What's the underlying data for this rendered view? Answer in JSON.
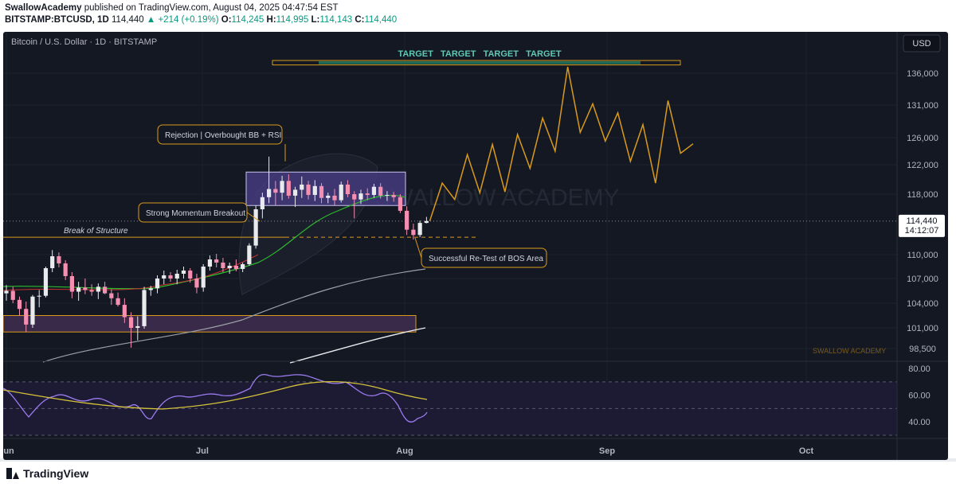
{
  "header": {
    "author": "SwallowAcademy",
    "published_text": " published on TradingView.com, August 04, 2025 04:47:54 EST",
    "symbol": "BITSTAMP:BTCUSD, 1D",
    "last": "114,440",
    "change": "▲ +214 (+0.19%)",
    "o_label": "O:",
    "o_value": "114,245",
    "h_label": "H:",
    "h_value": "114,995",
    "l_label": "L:",
    "l_value": "114,143",
    "c_label": "C:",
    "c_value": "114,440"
  },
  "chart_title": "Bitcoin / U.S. Dollar · 1D · BITSTAMP",
  "currency_button": "USD",
  "price_tag": {
    "price": "114,440",
    "countdown": "14:12:07"
  },
  "watermark": "SWALLOW ACADEMY",
  "corner_label": "SWALLOW ACADEMY",
  "target_label": "TARGET   TARGET   TARGET   TARGET",
  "annotations": {
    "rejection": "Rejection | Overbought BB + RSI",
    "momentum": "Strong Momentum Breakout",
    "bos": "Break of Structure",
    "retest": "Successful Re-Test of BOS Area"
  },
  "colors": {
    "background": "#141823",
    "up": "#e8eaed",
    "down": "#f48fb1",
    "accent": "#d99a1c",
    "target_fill": "#1f6b56",
    "sma_fast": "#2db92d",
    "rsi": "#9b7bf0",
    "rsi_ma": "#d4c33a"
  },
  "footer": {
    "brand": "TradingView"
  },
  "chart_data": {
    "type": "candlestick",
    "title": "Bitcoin / U.S. Dollar · 1D · BITSTAMP",
    "y_ticks": [
      136000,
      131000,
      126000,
      122000,
      118000,
      110000,
      107000,
      104000,
      101000,
      98500
    ],
    "y_tick_labels": [
      "136,000",
      "131,000",
      "126,000",
      "122,000",
      "118,000",
      "110,000",
      "107,000",
      "104,000",
      "101,000",
      "98,500"
    ],
    "x_labels": [
      "Jun",
      "Jul",
      "Aug",
      "Sep",
      "Oct"
    ],
    "last_price": 114440,
    "candles": [
      {
        "o": 105200,
        "h": 106200,
        "l": 104300,
        "c": 105500
      },
      {
        "o": 105500,
        "h": 106000,
        "l": 104000,
        "c": 104400
      },
      {
        "o": 104400,
        "h": 104800,
        "l": 102500,
        "c": 103300
      },
      {
        "o": 103300,
        "h": 104200,
        "l": 100500,
        "c": 101400
      },
      {
        "o": 101400,
        "h": 105000,
        "l": 101000,
        "c": 104800
      },
      {
        "o": 104800,
        "h": 105600,
        "l": 103500,
        "c": 104900
      },
      {
        "o": 104900,
        "h": 108500,
        "l": 104700,
        "c": 108300
      },
      {
        "o": 108300,
        "h": 110600,
        "l": 107800,
        "c": 109800
      },
      {
        "o": 109800,
        "h": 110300,
        "l": 108400,
        "c": 108900
      },
      {
        "o": 108900,
        "h": 109300,
        "l": 106800,
        "c": 107300
      },
      {
        "o": 107300,
        "h": 107800,
        "l": 104600,
        "c": 105400
      },
      {
        "o": 105400,
        "h": 106600,
        "l": 104300,
        "c": 105900
      },
      {
        "o": 105900,
        "h": 107000,
        "l": 105100,
        "c": 105600
      },
      {
        "o": 105600,
        "h": 106300,
        "l": 104900,
        "c": 105400
      },
      {
        "o": 105400,
        "h": 106400,
        "l": 104500,
        "c": 106000
      },
      {
        "o": 106000,
        "h": 106600,
        "l": 105100,
        "c": 105200
      },
      {
        "o": 105200,
        "h": 105700,
        "l": 103800,
        "c": 104600
      },
      {
        "o": 104600,
        "h": 105300,
        "l": 103600,
        "c": 103800
      },
      {
        "o": 103800,
        "h": 104600,
        "l": 101600,
        "c": 102300
      },
      {
        "o": 102300,
        "h": 102900,
        "l": 98600,
        "c": 101000
      },
      {
        "o": 101000,
        "h": 102400,
        "l": 99500,
        "c": 101200
      },
      {
        "o": 101200,
        "h": 106000,
        "l": 100900,
        "c": 105600
      },
      {
        "o": 105600,
        "h": 106100,
        "l": 104900,
        "c": 105800
      },
      {
        "o": 105800,
        "h": 107400,
        "l": 105200,
        "c": 107000
      },
      {
        "o": 107000,
        "h": 108000,
        "l": 106300,
        "c": 107400
      },
      {
        "o": 107400,
        "h": 107800,
        "l": 106600,
        "c": 107000
      },
      {
        "o": 107000,
        "h": 108100,
        "l": 106300,
        "c": 107600
      },
      {
        "o": 107600,
        "h": 108500,
        "l": 107000,
        "c": 108000
      },
      {
        "o": 108000,
        "h": 108300,
        "l": 106500,
        "c": 107000
      },
      {
        "o": 107000,
        "h": 107600,
        "l": 105200,
        "c": 105900
      },
      {
        "o": 105900,
        "h": 108800,
        "l": 105400,
        "c": 108500
      },
      {
        "o": 108500,
        "h": 109900,
        "l": 108000,
        "c": 109400
      },
      {
        "o": 109400,
        "h": 110100,
        "l": 108400,
        "c": 109000
      },
      {
        "o": 109000,
        "h": 109600,
        "l": 107800,
        "c": 108300
      },
      {
        "o": 108300,
        "h": 109000,
        "l": 107600,
        "c": 108600
      },
      {
        "o": 108600,
        "h": 109400,
        "l": 107900,
        "c": 108200
      },
      {
        "o": 108200,
        "h": 109000,
        "l": 107800,
        "c": 108800
      },
      {
        "o": 108800,
        "h": 111500,
        "l": 108600,
        "c": 111200
      },
      {
        "o": 111200,
        "h": 116500,
        "l": 110800,
        "c": 116000
      },
      {
        "o": 116000,
        "h": 118200,
        "l": 114800,
        "c": 117600
      },
      {
        "o": 117600,
        "h": 123200,
        "l": 116800,
        "c": 118700
      },
      {
        "o": 118700,
        "h": 119800,
        "l": 116500,
        "c": 118200
      },
      {
        "o": 118200,
        "h": 120500,
        "l": 117200,
        "c": 119800
      },
      {
        "o": 119800,
        "h": 120700,
        "l": 117400,
        "c": 117800
      },
      {
        "o": 117800,
        "h": 119000,
        "l": 116300,
        "c": 118600
      },
      {
        "o": 118600,
        "h": 120400,
        "l": 117500,
        "c": 119300
      },
      {
        "o": 119300,
        "h": 119800,
        "l": 117300,
        "c": 117900
      },
      {
        "o": 117900,
        "h": 119900,
        "l": 117100,
        "c": 119100
      },
      {
        "o": 119100,
        "h": 119500,
        "l": 116800,
        "c": 117500
      },
      {
        "o": 117500,
        "h": 118200,
        "l": 116800,
        "c": 117800
      },
      {
        "o": 117800,
        "h": 118700,
        "l": 116500,
        "c": 117200
      },
      {
        "o": 117200,
        "h": 119700,
        "l": 116900,
        "c": 119300
      },
      {
        "o": 119300,
        "h": 119900,
        "l": 117600,
        "c": 118000
      },
      {
        "o": 118000,
        "h": 118400,
        "l": 114800,
        "c": 117300
      },
      {
        "o": 117300,
        "h": 118600,
        "l": 116700,
        "c": 118100
      },
      {
        "o": 118100,
        "h": 118800,
        "l": 117200,
        "c": 117900
      },
      {
        "o": 117900,
        "h": 119400,
        "l": 117500,
        "c": 119000
      },
      {
        "o": 119000,
        "h": 119500,
        "l": 117400,
        "c": 117800
      },
      {
        "o": 117800,
        "h": 118400,
        "l": 117100,
        "c": 117900
      },
      {
        "o": 117900,
        "h": 118300,
        "l": 117000,
        "c": 117600
      },
      {
        "o": 117600,
        "h": 118000,
        "l": 115500,
        "c": 115800
      },
      {
        "o": 115800,
        "h": 116400,
        "l": 112600,
        "c": 113300
      },
      {
        "o": 113300,
        "h": 114100,
        "l": 112000,
        "c": 112600
      },
      {
        "o": 112600,
        "h": 114500,
        "l": 112300,
        "c": 114200
      },
      {
        "o": 114200,
        "h": 114995,
        "l": 114143,
        "c": 114440
      }
    ],
    "projection_path": [
      114440,
      119500,
      117300,
      123500,
      118200,
      125000,
      118300,
      126500,
      121500,
      129000,
      124000,
      137000,
      126800,
      131200,
      125500,
      129800,
      122500,
      128000,
      119500,
      131700,
      123700,
      125100
    ],
    "levels": {
      "bos_level": 112300,
      "target_zone": [
        137300,
        138000
      ],
      "demand_zone": [
        100500,
        102500
      ],
      "consolidation_zone": [
        116500,
        121000
      ]
    },
    "rsi": {
      "y_ticks": [
        80,
        60,
        40
      ],
      "y_tick_labels": [
        "80.00",
        "60.00",
        "40.00"
      ],
      "bands": [
        70,
        50,
        30
      ]
    }
  }
}
